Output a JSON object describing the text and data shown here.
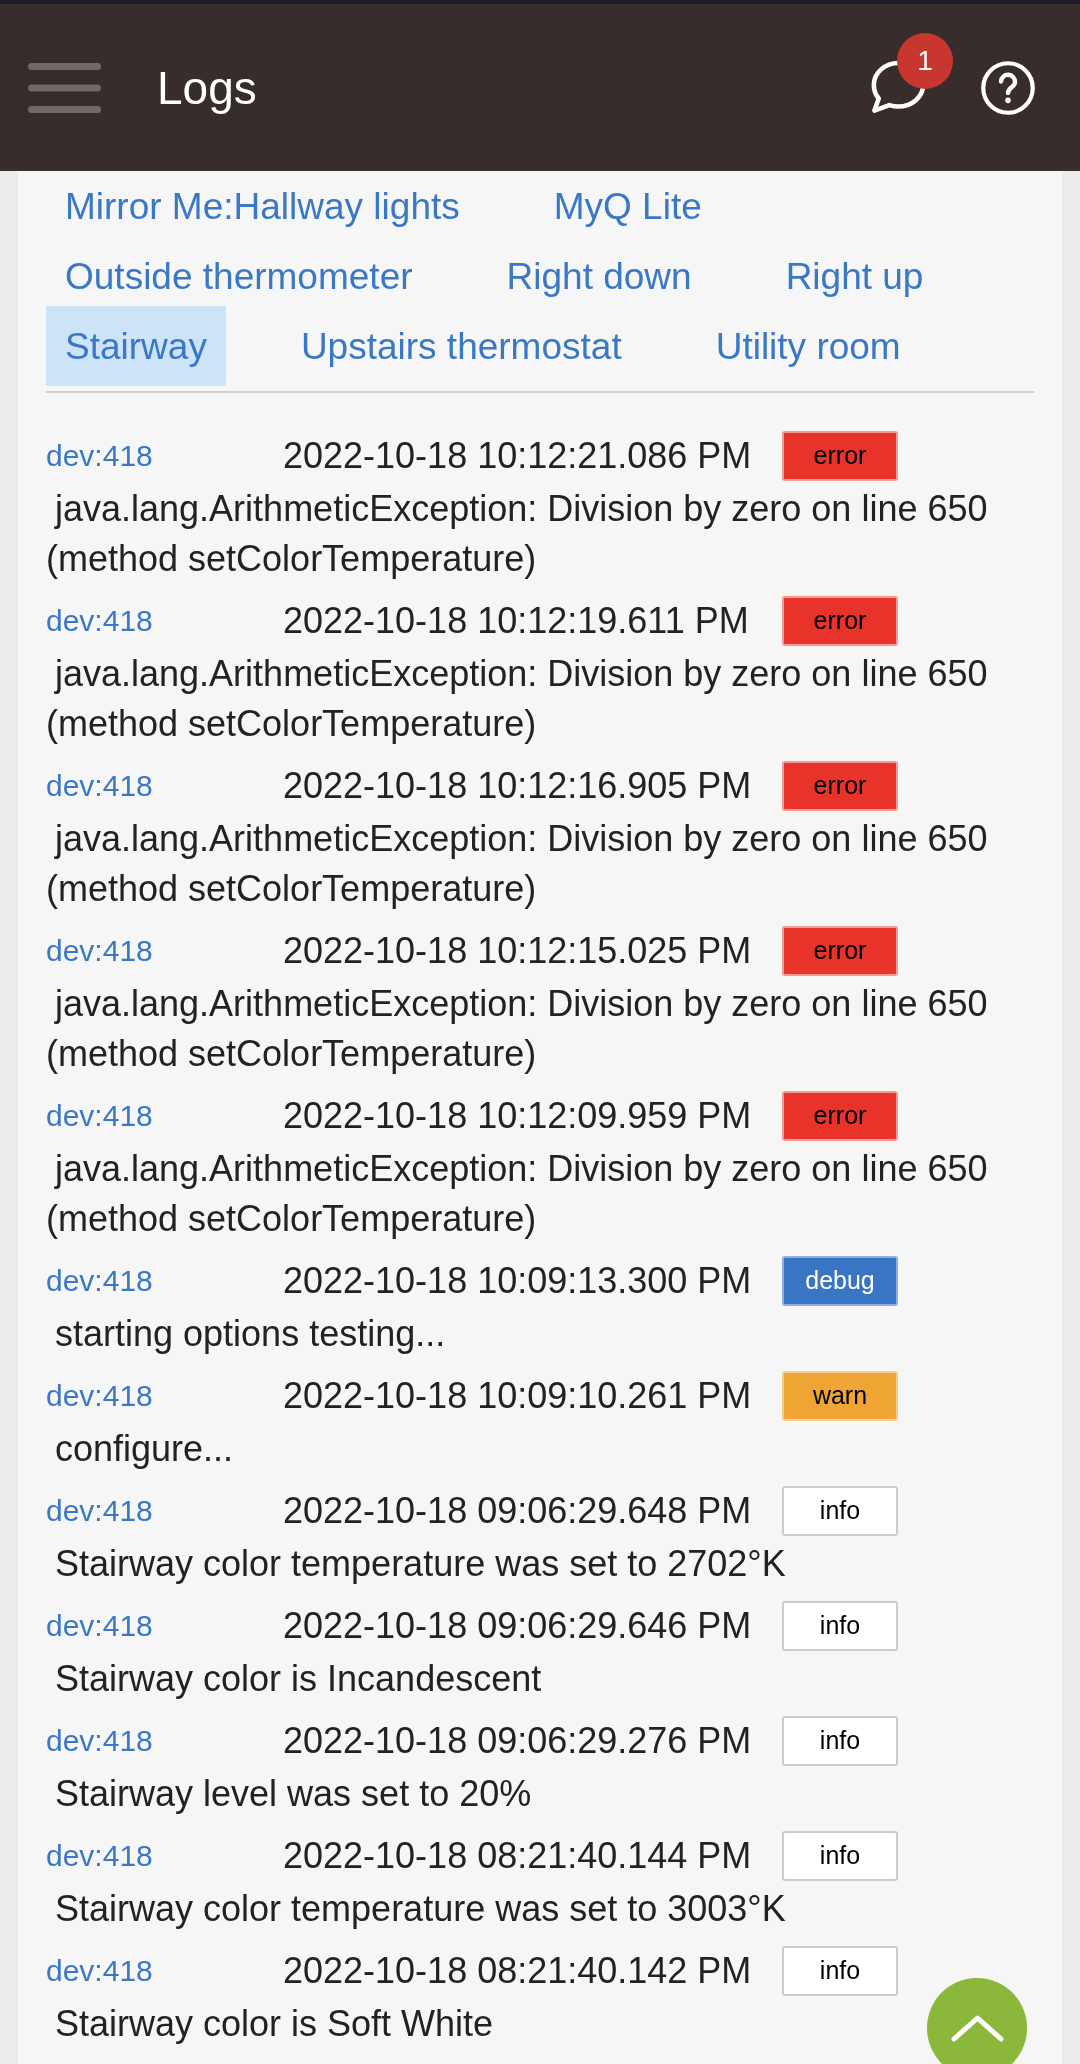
{
  "header": {
    "title": "Logs",
    "notification_count": "1"
  },
  "device_tabs": [
    {
      "label": "Mirror Me:Hallway lights",
      "selected": false
    },
    {
      "label": "MyQ Lite",
      "selected": false
    },
    {
      "label": "Outside thermometer",
      "selected": false
    },
    {
      "label": "Right down",
      "selected": false
    },
    {
      "label": "Right up",
      "selected": false
    },
    {
      "label": "Stairway",
      "selected": true
    },
    {
      "label": "Upstairs thermostat",
      "selected": false
    },
    {
      "label": "Utility room",
      "selected": false
    }
  ],
  "log_entries": [
    {
      "source": "dev:418",
      "timestamp": "2022-10-18 10:12:21.086 PM",
      "kind": "error",
      "badge": "error",
      "message": "java.lang.ArithmeticException: Division by zero on line 650 (method setColorTemperature)"
    },
    {
      "source": "dev:418",
      "timestamp": "2022-10-18 10:12:19.611 PM",
      "kind": "error",
      "badge": "error",
      "message": "java.lang.ArithmeticException: Division by zero on line 650 (method setColorTemperature)"
    },
    {
      "source": "dev:418",
      "timestamp": "2022-10-18 10:12:16.905 PM",
      "kind": "error",
      "badge": "error",
      "message": "java.lang.ArithmeticException: Division by zero on line 650 (method setColorTemperature)"
    },
    {
      "source": "dev:418",
      "timestamp": "2022-10-18 10:12:15.025 PM",
      "kind": "error",
      "badge": "error",
      "message": "java.lang.ArithmeticException: Division by zero on line 650 (method setColorTemperature)"
    },
    {
      "source": "dev:418",
      "timestamp": "2022-10-18 10:12:09.959 PM",
      "kind": "error",
      "badge": "error",
      "message": "java.lang.ArithmeticException: Division by zero on line 650 (method setColorTemperature)"
    },
    {
      "source": "dev:418",
      "timestamp": "2022-10-18 10:09:13.300 PM",
      "kind": "debug",
      "badge": "debug",
      "message": "starting options testing..."
    },
    {
      "source": "dev:418",
      "timestamp": "2022-10-18 10:09:10.261 PM",
      "kind": "warn",
      "badge": "warn",
      "message": "configure..."
    },
    {
      "source": "dev:418",
      "timestamp": "2022-10-18 09:06:29.648 PM",
      "kind": "info",
      "badge": "info",
      "message": "Stairway color temperature was set to 2702°K"
    },
    {
      "source": "dev:418",
      "timestamp": "2022-10-18 09:06:29.646 PM",
      "kind": "info",
      "badge": "info",
      "message": "Stairway color is Incandescent"
    },
    {
      "source": "dev:418",
      "timestamp": "2022-10-18 09:06:29.276 PM",
      "kind": "info",
      "badge": "info",
      "message": "Stairway level was set to 20%"
    },
    {
      "source": "dev:418",
      "timestamp": "2022-10-18 08:21:40.144 PM",
      "kind": "info",
      "badge": "info",
      "message": "Stairway color temperature was set to 3003°K"
    },
    {
      "source": "dev:418",
      "timestamp": "2022-10-18 08:21:40.142 PM",
      "kind": "info",
      "badge": "info",
      "message": "Stairway color is Soft White"
    }
  ]
}
